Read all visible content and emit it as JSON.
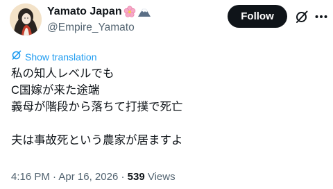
{
  "author": {
    "display_name": "Yamato Japan",
    "handle": "@Empire_Yamato",
    "badges": [
      "cherry-blossom-emoji",
      "mount-fuji-emoji"
    ]
  },
  "actions": {
    "follow_label": "Follow",
    "grok_icon": "grok-icon",
    "more_icon": "more-icon"
  },
  "translation": {
    "label": "Show translation",
    "icon": "translate-icon"
  },
  "tweet": {
    "lines": [
      "私の知人レベルでも",
      "C国嫁が来た途端",
      "義母が階段から落ちて打撲で死亡",
      "",
      "夫は事故死という農家が居ますよ"
    ]
  },
  "meta": {
    "time": "4:16 PM",
    "sep1": "·",
    "date": "Apr 16, 2026",
    "sep2": "·",
    "views_count": "539",
    "views_label": "Views"
  },
  "colors": {
    "accent": "#1d9bf0",
    "muted": "#536471",
    "text": "#0f1419",
    "button": "#0f1419"
  }
}
